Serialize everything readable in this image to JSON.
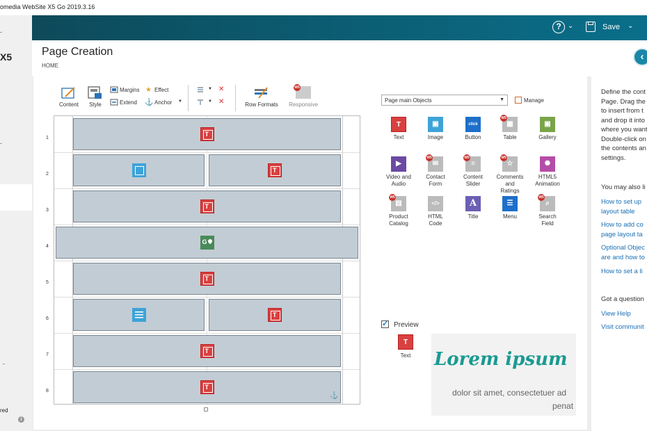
{
  "window": {
    "title": "omedia WebSite X5 Go 2019.3.16"
  },
  "sidebar": {
    "brand": "X5",
    "footer_text": "red"
  },
  "topbar": {
    "save_label": "Save"
  },
  "header": {
    "title": "Page Creation",
    "breadcrumb": "HOME"
  },
  "toolbar": {
    "content": "Content",
    "style": "Style",
    "margins": "Margins",
    "extend": "Extend",
    "effect": "Effect",
    "anchor": "Anchor",
    "row_formats": "Row Formats",
    "responsive": "Responsive"
  },
  "grid": {
    "rows": [
      "1",
      "2",
      "3",
      "4",
      "5",
      "6",
      "7",
      "8"
    ]
  },
  "objects": {
    "category": "Page main Objects",
    "manage": "Manage",
    "items": [
      {
        "l1": "Text",
        "l2": ""
      },
      {
        "l1": "Image",
        "l2": ""
      },
      {
        "l1": "Button",
        "l2": ""
      },
      {
        "l1": "Table",
        "l2": ""
      },
      {
        "l1": "Gallery",
        "l2": ""
      },
      {
        "l1": "Video and",
        "l2": "Audio"
      },
      {
        "l1": "Contact",
        "l2": "Form"
      },
      {
        "l1": "Content",
        "l2": "Slider"
      },
      {
        "l1": "Comments",
        "l2": "and",
        "l3": "Ratings"
      },
      {
        "l1": "HTML5",
        "l2": "Animation"
      },
      {
        "l1": "Product",
        "l2": "Catalog"
      },
      {
        "l1": "HTML",
        "l2": "Code"
      },
      {
        "l1": "Title",
        "l2": ""
      },
      {
        "l1": "Menu",
        "l2": ""
      },
      {
        "l1": "Search",
        "l2": "Field"
      }
    ]
  },
  "preview": {
    "label": "Preview",
    "object_label": "Text",
    "heading": "Lorem ipsum",
    "body": "dolor sit amet, consectetuer ad",
    "body2": "penat"
  },
  "help": {
    "para": [
      "Define the cont",
      "Page. Drag the",
      "to insert from t",
      "and drop it into",
      "where you want",
      "Double-click on",
      "the contents an",
      "settings."
    ],
    "also": "You may also li",
    "links": [
      [
        "How to set up",
        "layout table"
      ],
      [
        "How to add co",
        "page layout ta"
      ],
      [
        "Optional Objec",
        "are and how to"
      ],
      [
        "How to set a li"
      ]
    ],
    "question": "Got a question",
    "view_help": "View Help",
    "visit": "Visit communit"
  }
}
